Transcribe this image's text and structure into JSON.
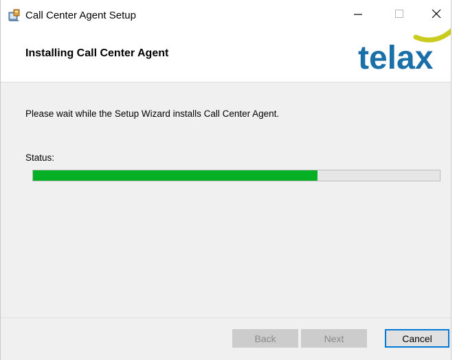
{
  "window": {
    "title": "Call Center Agent Setup",
    "minimize_glyph": "—",
    "maximize_glyph": "☐",
    "close_glyph": "✕"
  },
  "banner": {
    "title": "Installing Call Center Agent",
    "logo_text": "telax",
    "logo_color": "#1a6fa8",
    "logo_accent_color": "#c9cc1f"
  },
  "body": {
    "message": "Please wait while the Setup Wizard installs Call Center Agent.",
    "status_label": "Status:",
    "progress_percent": 70,
    "progress_color": "#06b025"
  },
  "footer": {
    "back_label": "Back",
    "next_label": "Next",
    "cancel_label": "Cancel"
  }
}
